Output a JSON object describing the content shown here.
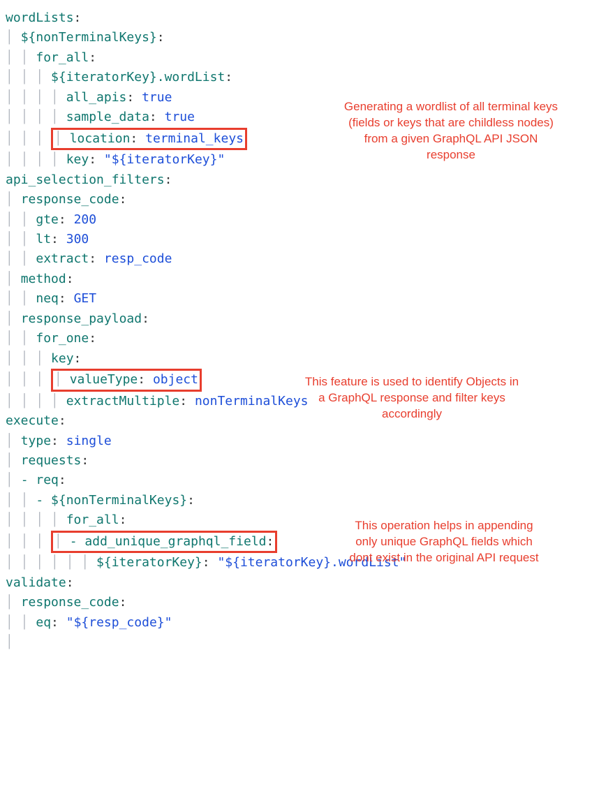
{
  "code": {
    "wordLists": "wordLists",
    "nonTerminalKeys1": "${nonTerminalKeys}",
    "for_all1": "for_all",
    "iteratorKeyWordList": "${iteratorKey}.wordList",
    "all_apis_k": "all_apis",
    "all_apis_v": "true",
    "sample_data_k": "sample_data",
    "sample_data_v": "true",
    "location_k": "location",
    "location_v": "terminal_keys",
    "key_k": "key",
    "key_v": "\"${iteratorKey}\"",
    "api_selection_filters": "api_selection_filters",
    "response_code_k": "response_code",
    "gte_k": "gte",
    "gte_v": "200",
    "lt_k": "lt",
    "lt_v": "300",
    "extract_k": "extract",
    "extract_v": "resp_code",
    "method_k": "method",
    "neq_k": "neq",
    "neq_v": "GET",
    "response_payload_k": "response_payload",
    "for_one_k": "for_one",
    "key2_k": "key",
    "valueType_k": "valueType",
    "valueType_v": "object",
    "extractMultiple_k": "extractMultiple",
    "extractMultiple_v": "nonTerminalKeys",
    "execute_k": "execute",
    "type_k": "type",
    "type_v": "single",
    "requests_k": "requests",
    "req_k": "req",
    "nonTerminalKeys2": "${nonTerminalKeys}",
    "for_all2": "for_all",
    "add_unique_graphql_field_k": "add_unique_graphql_field",
    "iteratorKey2_k": "${iteratorKey}",
    "iteratorKey2_v": "\"${iteratorKey}.wordList\"",
    "validate_k": "validate",
    "response_code2_k": "response_code",
    "eq_k": "eq",
    "eq_v": "\"${resp_code}\""
  },
  "annotations": {
    "anno1": "Generating a wordlist of all terminal keys (fields or keys that are childless nodes) from a given GraphQL API JSON response",
    "anno2": "This feature is used to identify Objects in a GraphQL response and filter keys accordingly",
    "anno3": "This operation helps in appending only unique GraphQL fields which dont exist in the original API request"
  }
}
